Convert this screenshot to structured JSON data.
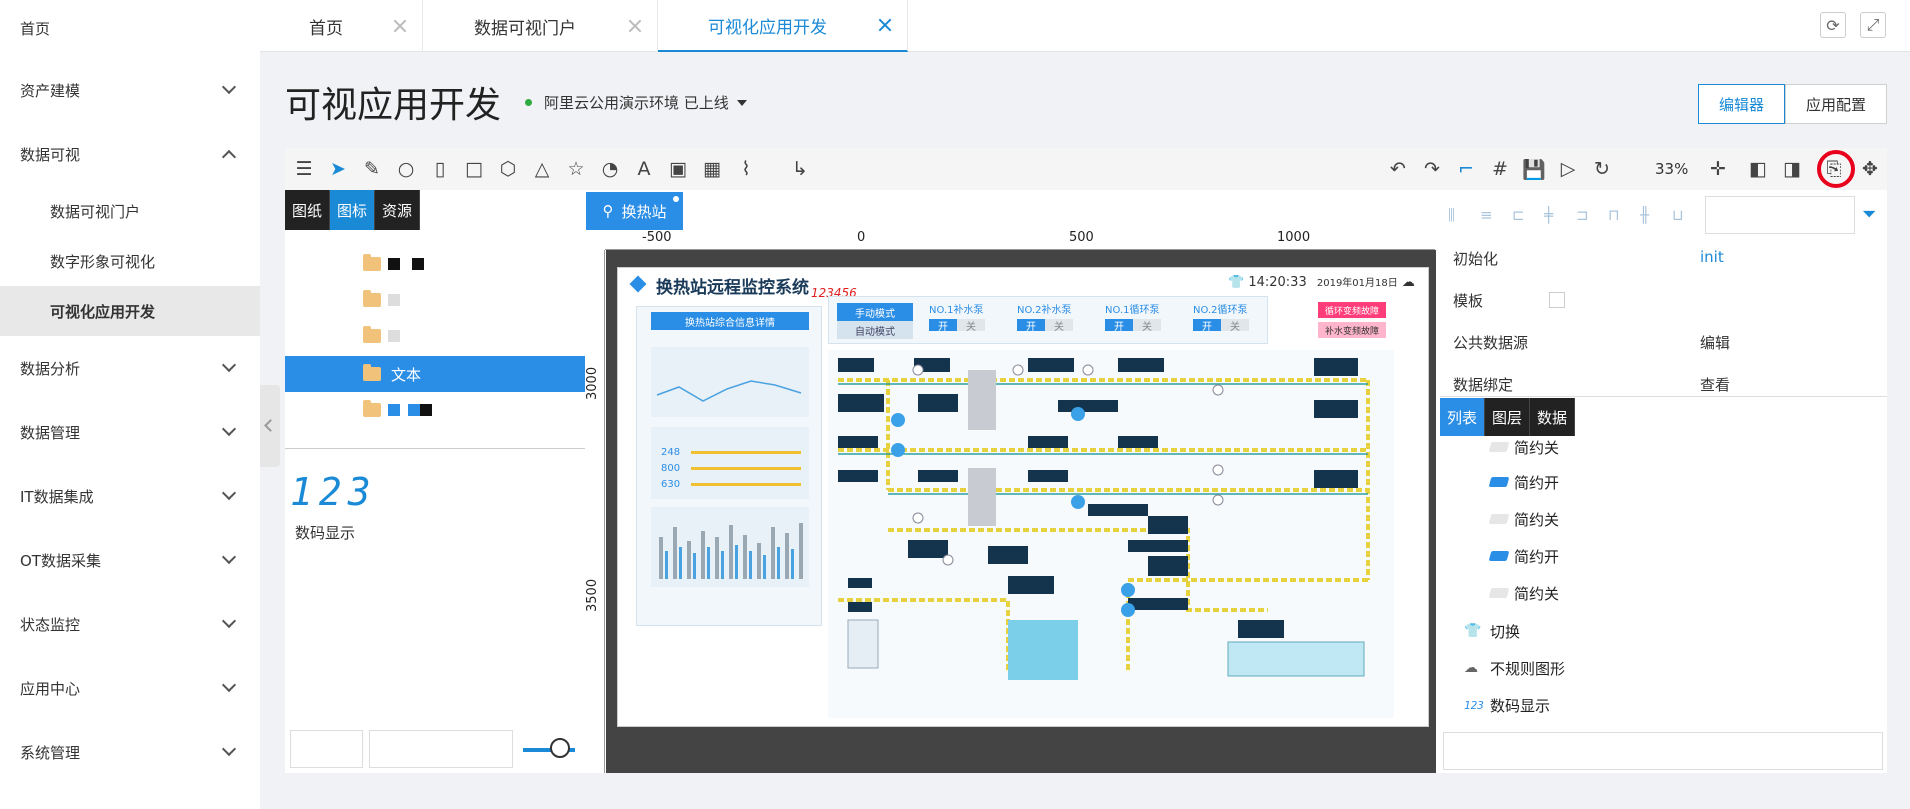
{
  "sidebar": {
    "home": "首页",
    "items": [
      {
        "label": "资产建模"
      },
      {
        "label": "数据可视"
      },
      {
        "label": "数据分析"
      },
      {
        "label": "数据管理"
      },
      {
        "label": "IT数据集成"
      },
      {
        "label": "OT数据采集"
      },
      {
        "label": "状态监控"
      },
      {
        "label": "应用中心"
      },
      {
        "label": "系统管理"
      }
    ],
    "sub_items": [
      {
        "label": "数据可视门户"
      },
      {
        "label": "数字形象可视化"
      },
      {
        "label": "可视化应用开发"
      }
    ]
  },
  "tabs": [
    {
      "label": "首页"
    },
    {
      "label": "数据可视门户"
    },
    {
      "label": "可视化应用开发"
    }
  ],
  "page": {
    "title": "可视应用开发",
    "env": "阿里云公用演示环境 已上线",
    "editor_btn": "编辑器",
    "config_btn": "应用配置"
  },
  "toolbar": {
    "zoom": "33%"
  },
  "left_panel": {
    "tabs": [
      "图纸",
      "图标",
      "资源"
    ],
    "selected_folder": "文本",
    "digits": "123",
    "digits_label": "数码显示"
  },
  "canvas": {
    "tab_label": "换热站",
    "ruler_h": [
      "-500",
      "0",
      "500",
      "1000"
    ],
    "ruler_v": [
      "3000",
      "3500"
    ],
    "scada": {
      "title": "换热站远程监控系统",
      "number": "123456",
      "time": "14:20:33",
      "date": "2019年01月18日",
      "info_title": "换热站综合信息详情",
      "manual": "手动模式",
      "auto": "自动模式",
      "pumps": [
        "NO.1补水泵",
        "NO.2补水泵",
        "NO.1循环泵",
        "NO.2循环泵"
      ],
      "on": "开",
      "off": "关",
      "fault1": "循环变频故障",
      "fault2": "补水变频故障",
      "vals": [
        "248",
        "800",
        "630"
      ]
    }
  },
  "right_panel": {
    "props": [
      {
        "key": "初始化",
        "value": "init"
      },
      {
        "key": "模板",
        "value": ""
      },
      {
        "key": "公共数据源",
        "value": "编辑"
      },
      {
        "key": "数据绑定",
        "value": "查看"
      }
    ],
    "tabs": [
      "列表",
      "图层",
      "数据"
    ],
    "layers": [
      {
        "label": "简约关",
        "state": "off"
      },
      {
        "label": "简约开",
        "state": "on"
      },
      {
        "label": "简约关",
        "state": "off"
      },
      {
        "label": "简约开",
        "state": "on"
      },
      {
        "label": "简约关",
        "state": "off"
      },
      {
        "label": "切换",
        "icon": "shirt-icon"
      },
      {
        "label": "不规则图形",
        "icon": "cloud-icon"
      },
      {
        "label": "数码显示",
        "icon": "digits-icon",
        "icon_text": "123"
      }
    ]
  }
}
